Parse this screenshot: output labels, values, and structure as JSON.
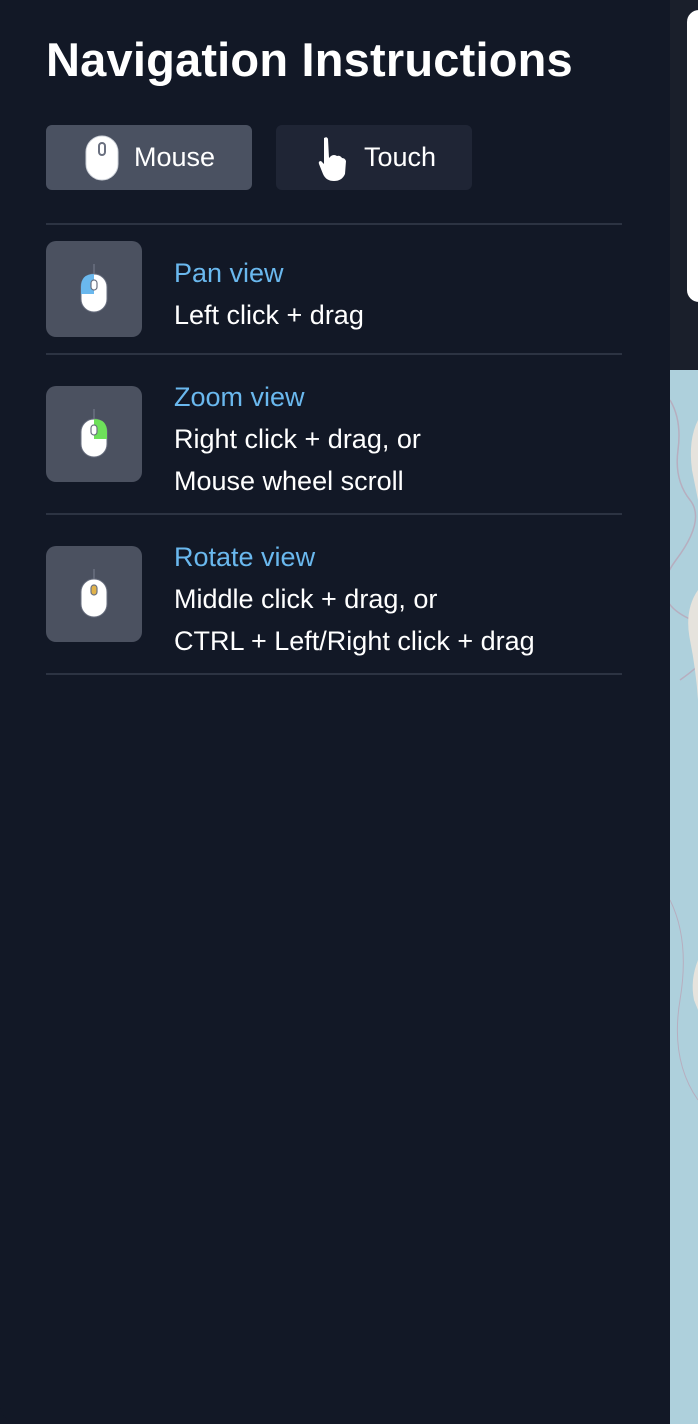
{
  "panel": {
    "title": "Navigation Instructions"
  },
  "tabs": [
    {
      "label": "Mouse",
      "icon": "mouse-icon",
      "selected": true
    },
    {
      "label": "Touch",
      "icon": "pointing-hand-icon",
      "selected": false
    }
  ],
  "instructions": [
    {
      "title": "Pan view",
      "lines": [
        "Left click + drag"
      ],
      "icon": "mouse-left-click-icon",
      "highlight_color": "#6ab8ee"
    },
    {
      "title": "Zoom view",
      "lines": [
        "Right click + drag, or",
        "Mouse wheel scroll"
      ],
      "icon": "mouse-right-click-icon",
      "highlight_color": "#6ee05a"
    },
    {
      "title": "Rotate view",
      "lines": [
        "Middle click + drag, or",
        "CTRL + Left/Right click + drag"
      ],
      "icon": "mouse-middle-click-icon",
      "highlight_color": "#e0b24a"
    }
  ],
  "colors": {
    "panel_background": "#121826",
    "accent": "#6ab8ee",
    "selected_tab": "#4a5161",
    "unselected_tab": "#1f2535",
    "map_water": "#aed0dc"
  }
}
